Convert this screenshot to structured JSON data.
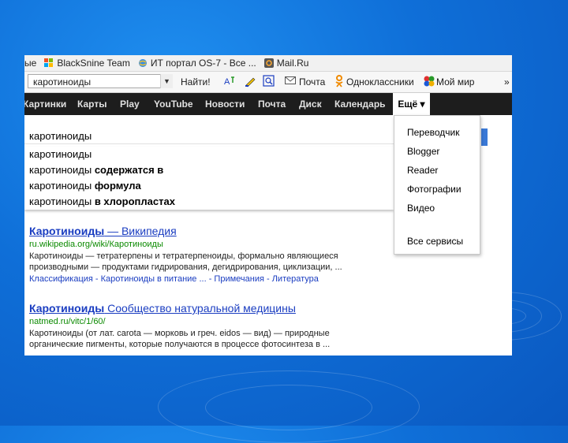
{
  "bookmarks": {
    "items": [
      {
        "label": "ые",
        "icon": "none"
      },
      {
        "label": "BlackSnine Team",
        "icon": "windows-flag-icon"
      },
      {
        "label": "ИТ портал OS-7 - Все ...",
        "icon": "globe-icon"
      },
      {
        "label": "Mail.Ru",
        "icon": "mailru-icon"
      }
    ]
  },
  "yandex_bar": {
    "search_value": "каротиноиды",
    "find_label": "Найти!",
    "mail_label": "Почта",
    "ok_label": "Одноклассники",
    "mymir_label": "Мой мир",
    "overflow": "»"
  },
  "services": {
    "items": [
      "Картинки",
      "Карты",
      "Play",
      "YouTube",
      "Новости",
      "Почта",
      "Диск",
      "Календарь"
    ],
    "more_label": "Ещё ▾"
  },
  "search": {
    "value": "каротиноиды",
    "suggestions": [
      {
        "base": "каротиноиды",
        "extra": ""
      },
      {
        "base": "каротиноиды",
        "extra": " содержатся в"
      },
      {
        "base": "каротиноиды",
        "extra": " формула"
      },
      {
        "base": "каротиноиды",
        "extra": " в хлоропластах"
      }
    ]
  },
  "more_menu": {
    "items": [
      "Переводчик",
      "Blogger",
      "Reader",
      "Фотографии",
      "Видео"
    ],
    "all_services": "Все сервисы"
  },
  "results": [
    {
      "title_bold": "Каротиноиды",
      "title_rest": " — Википедия",
      "url": "ru.wikipedia.org/wiki/Каротиноиды",
      "snippet": [
        "Каротиноиды — тетратерпены и тетратерпеноиды, формально являющиеся",
        "производными — продуктами гидрирования, дегидрирования, циклизации, ..."
      ],
      "links": "Классификация - Каротиноиды в питание ... - Примечания - Литература"
    },
    {
      "title_bold": "Каротиноиды",
      "title_rest": " Сообщество натуральной медицины",
      "url": "natmed.ru/vitc/1/60/",
      "snippet": [
        "Каротиноиды (от лат. carota — морковь и греч. eidos — вид) — природные",
        "органические пигменты, которые получаются в процессе фотосинтеза в ..."
      ],
      "links": ""
    }
  ],
  "colors": {
    "link": "#1a3dc1",
    "url": "#0b8a00",
    "menu_bg": "#1d1d1d",
    "slide_bg": "#0f6fd8"
  }
}
